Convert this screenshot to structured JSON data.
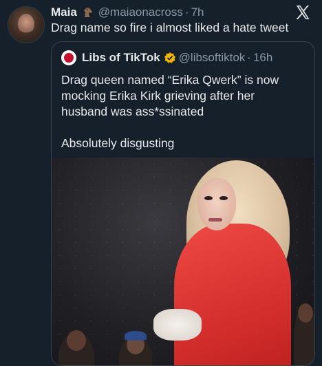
{
  "tweet": {
    "author_name": "Maia",
    "author_handle": "@maiaonacross",
    "separator": "·",
    "time": "7h",
    "text": "Drag name so fire i almost liked a hate tweet",
    "badge_icon": "horse-icon",
    "app_icon": "x-logo-icon"
  },
  "quoted_tweet": {
    "author_name": "Libs of TikTok",
    "author_handle": "@libsoftiktok",
    "separator": "·",
    "time": "16h",
    "verified_icon": "verified-badge-icon",
    "text_line1": "Drag queen named “Erika Qwerk” is now mocking Erika Kirk grieving after her husband was ass*ssinated",
    "text_line2": "Absolutely disgusting",
    "media_icon": "video-still-image"
  },
  "colors": {
    "background": "#15202b",
    "text": "#e7e9ea",
    "secondary_text": "#8b98a5",
    "border": "#38444d",
    "verified": "#f4b400"
  }
}
